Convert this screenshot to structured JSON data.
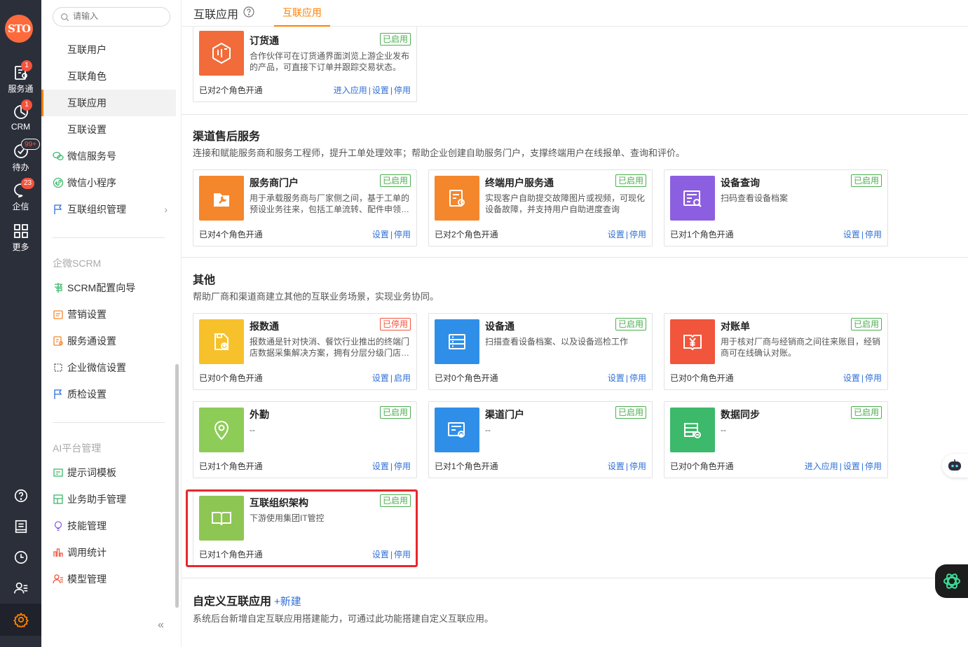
{
  "rail": {
    "logo": "STO",
    "items": [
      {
        "label": "服务通",
        "badge": "1",
        "icon": "service-icon"
      },
      {
        "label": "CRM",
        "badge": "1",
        "icon": "crm-icon"
      },
      {
        "label": "待办",
        "badge": "99+",
        "icon": "todo-icon"
      },
      {
        "label": "企信",
        "badge": "23",
        "icon": "chat-icon"
      },
      {
        "label": "更多",
        "badge": "",
        "icon": "grid-icon"
      }
    ]
  },
  "menu": {
    "search_placeholder": "请输入",
    "items": [
      {
        "label": "互联用户"
      },
      {
        "label": "互联角色"
      },
      {
        "label": "互联应用"
      },
      {
        "label": "互联设置"
      },
      {
        "label": "微信服务号"
      },
      {
        "label": "微信小程序"
      },
      {
        "label": "互联组织管理"
      }
    ],
    "group_scrm": "企微SCRM",
    "scrm_items": [
      {
        "label": "SCRM配置向导"
      },
      {
        "label": "营销设置"
      },
      {
        "label": "服务通设置"
      },
      {
        "label": "企业微信设置"
      },
      {
        "label": "质检设置"
      }
    ],
    "group_ai": "AI平台管理",
    "ai_items": [
      {
        "label": "提示词模板"
      },
      {
        "label": "业务助手管理"
      },
      {
        "label": "技能管理"
      },
      {
        "label": "调用统计"
      },
      {
        "label": "模型管理"
      }
    ],
    "collapse": "«"
  },
  "header": {
    "title": "互联应用",
    "tab": "互联应用"
  },
  "top_card": {
    "name": "订货通",
    "status": "已启用",
    "desc": "合作伙伴可在订货通界面浏览上游企业发布的产品，可直接下订单并跟踪交易状态。",
    "count": "已对2个角色开通",
    "actions": [
      "进入应用",
      "设置",
      "停用"
    ]
  },
  "sections": {
    "channel": {
      "title": "渠道售后服务",
      "desc": "连接和赋能服务商和服务工程师，提升工单处理效率；帮助企业创建自助服务门户，支撑终端用户在线报单、查询和评价。",
      "cards": [
        {
          "name": "服务商门户",
          "status": "已启用",
          "desc": "用于承载服务商与厂家侧之间，基于工单的预设业务往来，包括工单流转、配件申领…",
          "count": "已对4个角色开通",
          "actions": [
            "设置",
            "停用"
          ]
        },
        {
          "name": "终端用户服务通",
          "status": "已启用",
          "desc": "实现客户自助提交故障图片或视频，可现化设备故障，并支持用户自助进度查询",
          "count": "已对2个角色开通",
          "actions": [
            "设置",
            "停用"
          ]
        },
        {
          "name": "设备查询",
          "status": "已启用",
          "desc": "扫码查看设备档案",
          "count": "已对1个角色开通",
          "actions": [
            "设置",
            "停用"
          ]
        }
      ]
    },
    "other": {
      "title": "其他",
      "desc": "帮助厂商和渠道商建立其他的互联业务场景，实现业务协同。",
      "cards": [
        {
          "name": "报数通",
          "status": "已停用",
          "desc": "报数通是针对快消、餐饮行业推出的终端门店数据采集解决方案，拥有分层分级门店…",
          "count": "已对0个角色开通",
          "actions": [
            "设置",
            "启用"
          ]
        },
        {
          "name": "设备通",
          "status": "已启用",
          "desc": "扫描查看设备档案、以及设备巡检工作",
          "count": "已对0个角色开通",
          "actions": [
            "设置",
            "停用"
          ]
        },
        {
          "name": "对账单",
          "status": "已启用",
          "desc": "用于核对厂商与经销商之间往来账目，经销商可在线确认对账。",
          "count": "已对0个角色开通",
          "actions": [
            "设置",
            "停用"
          ]
        },
        {
          "name": "外勤",
          "status": "已启用",
          "desc": "--",
          "count": "已对1个角色开通",
          "actions": [
            "设置",
            "停用"
          ]
        },
        {
          "name": "渠道门户",
          "status": "已启用",
          "desc": "--",
          "count": "已对1个角色开通",
          "actions": [
            "设置",
            "停用"
          ]
        },
        {
          "name": "数据同步",
          "status": "已启用",
          "desc": "--",
          "count": "已对0个角色开通",
          "actions": [
            "进入应用",
            "设置",
            "停用"
          ]
        },
        {
          "name": "互联组织架构",
          "status": "已启用",
          "desc": "下游使用集团IT管控",
          "count": "已对1个角色开通",
          "actions": [
            "设置",
            "停用"
          ]
        }
      ]
    },
    "custom": {
      "title": "自定义互联应用",
      "new_label": "+新建",
      "desc": "系统后台新增自定互联应用搭建能力，可通过此功能搭建自定义互联应用。"
    }
  },
  "colors": {
    "accent": "#ff8000",
    "link": "#2f6fd6",
    "enabled": "#4caf50",
    "disabled": "#f5533d",
    "highlight": "#e8282b",
    "icon_orange": "#f26b3a",
    "icon_orange2": "#f4862c",
    "icon_purple": "#8c5fe0",
    "icon_yellow": "#f7c12b",
    "icon_blue": "#2f8fe8",
    "icon_red": "#f1553c",
    "icon_lightgreen": "#8dcc57",
    "icon_green": "#3cb96a",
    "icon_olive": "#8ec653"
  }
}
